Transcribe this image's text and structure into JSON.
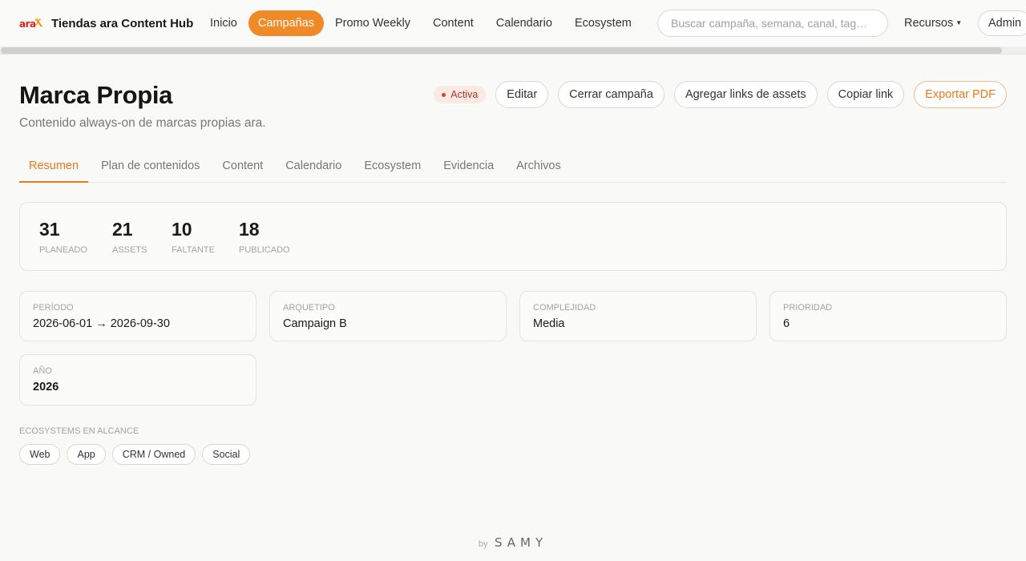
{
  "brand": {
    "logo_text": "ara",
    "name": "Tiendas ara Content Hub"
  },
  "nav": {
    "items": [
      {
        "label": "Inicio"
      },
      {
        "label": "Campañas"
      },
      {
        "label": "Promo Weekly"
      },
      {
        "label": "Content"
      },
      {
        "label": "Calendario"
      },
      {
        "label": "Ecosystem"
      }
    ],
    "active": "Campañas",
    "search_placeholder": "Buscar campaña, semana, canal, tag…",
    "recursos": "Recursos",
    "admin": "Admin"
  },
  "header": {
    "title": "Marca Propia",
    "subtitle": "Contenido always-on de marcas propias ara.",
    "status": "Activa",
    "actions": {
      "edit": "Editar",
      "close": "Cerrar campaña",
      "add_links": "Agregar links de assets",
      "copy_link": "Copiar link",
      "export": "Exportar PDF"
    }
  },
  "tabs": [
    {
      "label": "Resumen"
    },
    {
      "label": "Plan de contenidos"
    },
    {
      "label": "Content"
    },
    {
      "label": "Calendario"
    },
    {
      "label": "Ecosystem"
    },
    {
      "label": "Evidencia"
    },
    {
      "label": "Archivos"
    }
  ],
  "stats": [
    {
      "value": "31",
      "label": "Planeado"
    },
    {
      "value": "21",
      "label": "Assets"
    },
    {
      "value": "10",
      "label": "Faltante"
    },
    {
      "value": "18",
      "label": "Publicado"
    }
  ],
  "details": [
    {
      "label": "Período",
      "value": "2026-06-01 → 2026-09-30"
    },
    {
      "label": "Arquetipo",
      "value": "Campaign B"
    },
    {
      "label": "Complejidad",
      "value": "Media"
    },
    {
      "label": "Prioridad",
      "value": "6"
    },
    {
      "label": "Año",
      "value": "2026"
    }
  ],
  "ecosystems": {
    "label": "Ecosystems en alcance",
    "items": [
      "Web",
      "App",
      "CRM / Owned",
      "Social"
    ]
  },
  "footer": {
    "by": "by",
    "mark": "SAMY"
  },
  "colors": {
    "accent": "#f08a26",
    "status_bg": "#fbe9e4",
    "status_text": "#b4332a"
  }
}
